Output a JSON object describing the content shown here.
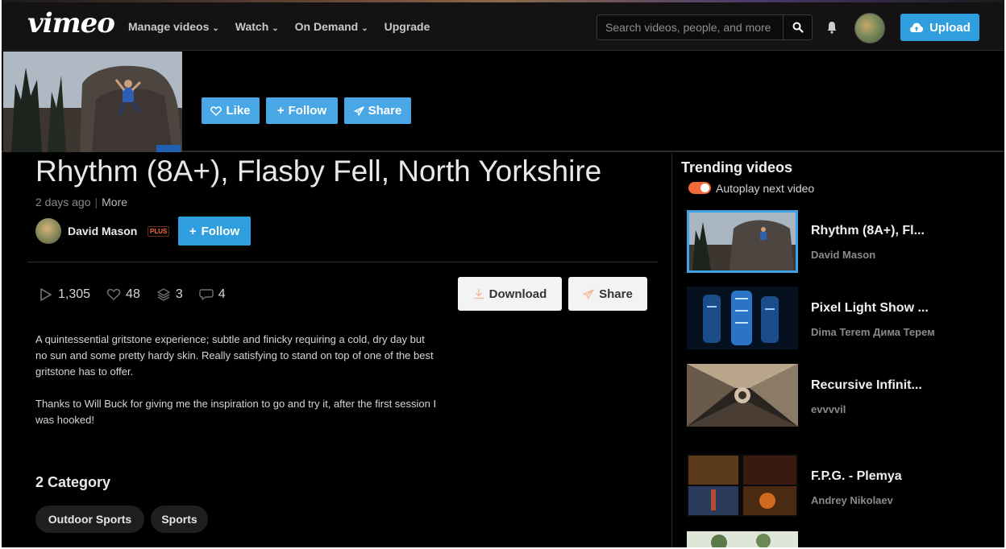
{
  "nav": {
    "logo": "vimeo",
    "links": [
      {
        "label": "Manage videos",
        "caret": true
      },
      {
        "label": "Watch",
        "caret": true
      },
      {
        "label": "On Demand",
        "caret": true
      },
      {
        "label": "Upgrade",
        "caret": false
      }
    ],
    "search_placeholder": "Search videos, people, and more",
    "upload_label": "Upload"
  },
  "header_actions": {
    "like": "Like",
    "follow": "Follow",
    "share": "Share"
  },
  "video": {
    "title": "Rhythm (8A+), Flasby Fell, North Yorkshire",
    "posted": "2 days ago",
    "more": "More",
    "author": "David Mason",
    "author_badge": "PLUS",
    "follow_label": "Follow",
    "stats": {
      "plays": "1,305",
      "likes": "48",
      "collections": "3",
      "comments": "4"
    },
    "download_label": "Download",
    "share_label": "Share",
    "description": [
      "A quintessential gritstone experience; subtle and finicky requiring a cold, dry day but no sun and some pretty hardy skin. Really satisfying to stand on top of one of the best gritstone has to offer.",
      "Thanks to Will Buck for giving me the inspiration to go and try it, after the first session I was hooked!"
    ],
    "category_title": "2 Category",
    "categories": [
      "Outdoor Sports",
      "Sports"
    ]
  },
  "sidebar": {
    "title": "Trending videos",
    "autoplay_label": "Autoplay next video",
    "autoplay_on": true,
    "videos": [
      {
        "title": "Rhythm (8A+), Fl...",
        "author": "David Mason",
        "active": true
      },
      {
        "title": "Pixel Light Show ...",
        "author": "Dima Terem Дима Терем",
        "active": false
      },
      {
        "title": "Recursive Infinit...",
        "author": "evvvvil",
        "active": false
      },
      {
        "title": "F.P.G. - Plemya",
        "author": "Andrey Nikolaev",
        "active": false
      }
    ]
  },
  "colors": {
    "accent": "#2f9fe0",
    "toggle": "#f26a3a",
    "background": "#000000"
  }
}
